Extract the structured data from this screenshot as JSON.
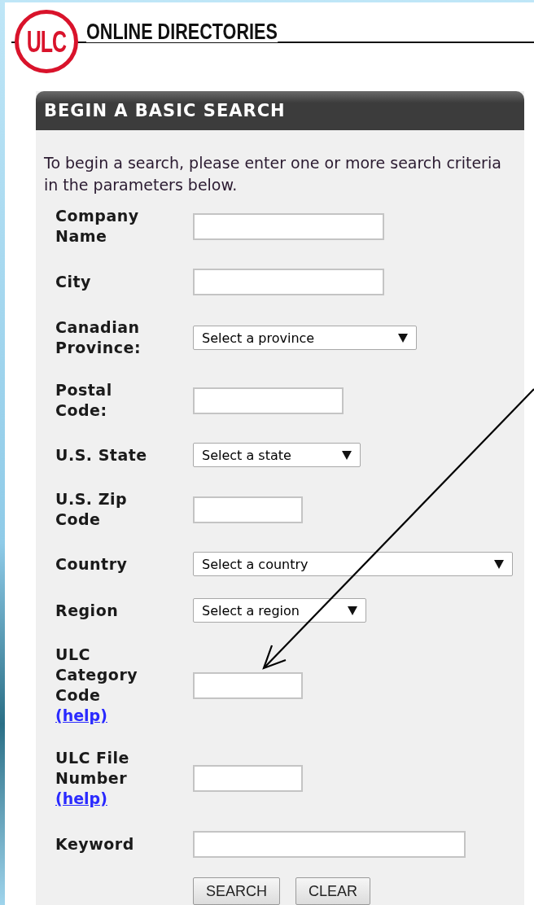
{
  "header": {
    "logo": "ULC",
    "title": "ONLINE DIRECTORIES"
  },
  "panel": {
    "title": "BEGIN A BASIC SEARCH",
    "intro": "To begin a search, please enter one or more search criteria in the parameters below.",
    "fields": [
      {
        "kind": "text",
        "label": "Company\nName"
      },
      {
        "kind": "text",
        "label": "City"
      },
      {
        "kind": "select",
        "label": "Canadian\nProvince:",
        "value": "Select a province"
      },
      {
        "kind": "text",
        "label": "Postal\nCode:"
      },
      {
        "kind": "select",
        "label": "U.S. State",
        "value": "Select a state"
      },
      {
        "kind": "text",
        "label": "U.S. Zip\nCode"
      },
      {
        "kind": "select",
        "label": "Country",
        "value": "Select a country"
      },
      {
        "kind": "select",
        "label": "Region",
        "value": "Select a region"
      },
      {
        "kind": "text",
        "label": "ULC\nCategory\nCode",
        "help": "(help)"
      },
      {
        "kind": "text",
        "label": "ULC File\nNumber",
        "help": "(help)"
      },
      {
        "kind": "text",
        "label": "Keyword"
      }
    ],
    "buttons": [
      "SEARCH",
      "CLEAR"
    ]
  }
}
